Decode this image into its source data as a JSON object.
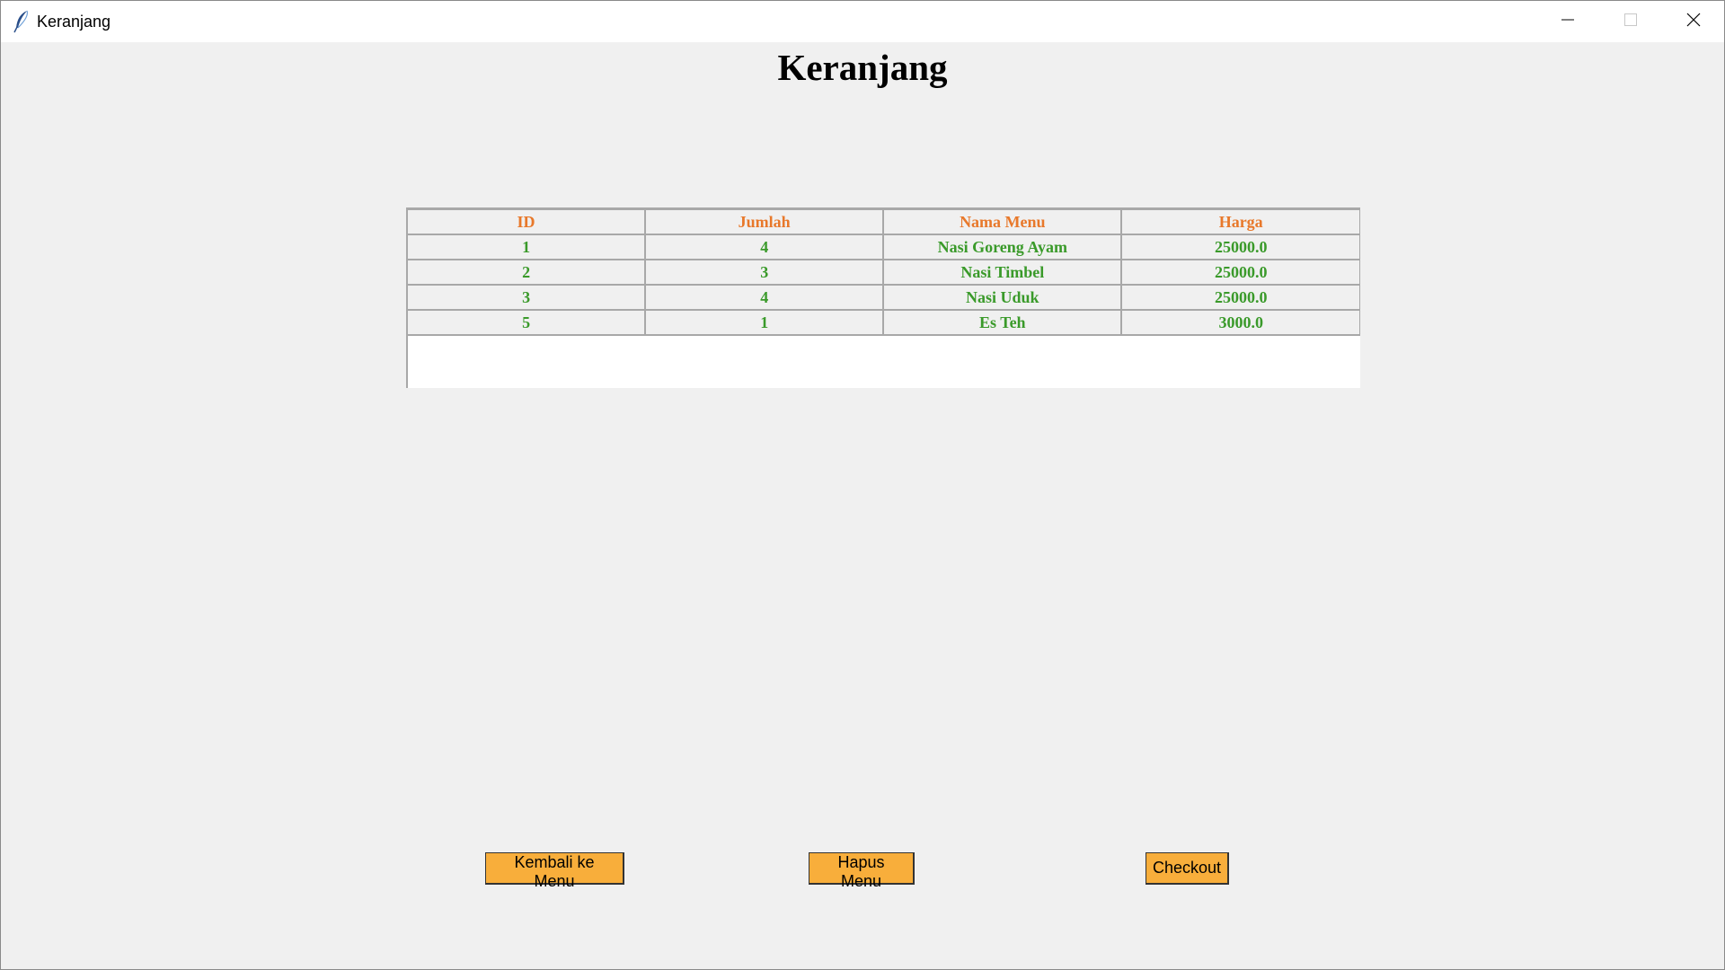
{
  "window": {
    "title": "Keranjang",
    "icons": {
      "app": "feather-icon",
      "minimize": "minimize-icon",
      "maximize": "maximize-icon",
      "close": "close-icon"
    }
  },
  "page": {
    "heading": "Keranjang"
  },
  "cart_table": {
    "columns": [
      "ID",
      "Jumlah",
      "Nama Menu",
      "Harga"
    ],
    "rows": [
      [
        "1",
        "4",
        "Nasi Goreng Ayam",
        "25000.0"
      ],
      [
        "2",
        "3",
        "Nasi Timbel",
        "25000.0"
      ],
      [
        "3",
        "4",
        "Nasi Uduk",
        "25000.0"
      ],
      [
        "5",
        "1",
        "Es Teh",
        "3000.0"
      ]
    ]
  },
  "actions": {
    "back_label": "Kembali ke Menu",
    "delete_label": "Hapus Menu",
    "checkout_label": "Checkout"
  },
  "colors": {
    "header_text": "#e8782a",
    "cell_text": "#3a9a2a",
    "button_bg": "#f8ae3b",
    "background": "#f0f0f0"
  }
}
